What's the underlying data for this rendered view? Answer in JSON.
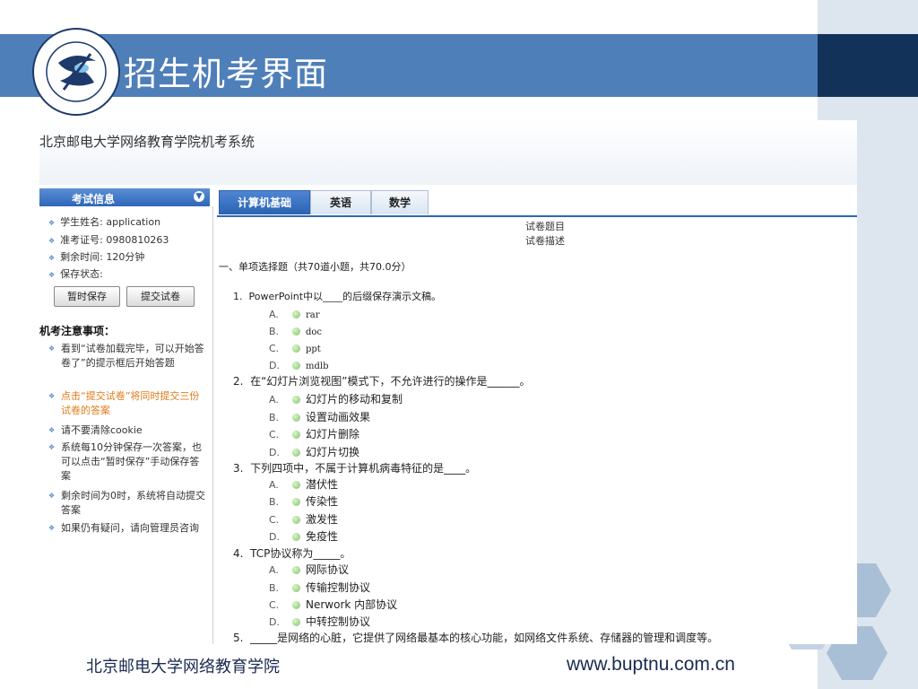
{
  "slide": {
    "title": "招生机考界面",
    "footer_left": "北京邮电大学网络教育学院",
    "footer_right": "www.buptnu.com.cn",
    "colors": {
      "header_blue": "#4f7fb9",
      "header_dark": "#13325a",
      "side_panel": "#dde5ee",
      "hex": "#a9bfd6"
    }
  },
  "app": {
    "system_title": "北京邮电大学网络教育学院机考系统",
    "sidebar": {
      "header": "考试信息",
      "info": [
        "学生姓名: application",
        "准考证号: 0980810263",
        "剩余时间: 120分钟",
        "保存状态:"
      ],
      "buttons": {
        "save": "暂时保存",
        "submit": "提交试卷"
      },
      "notice_title": "机考注意事项：",
      "notices": [
        "看到“试卷加载完毕，可以开始答卷了”的提示框后开始答题",
        "点击“提交试卷”将同时提交三份试卷的答案",
        "请不要清除cookie",
        "系统每10分钟保存一次答案，也可以点击“暂时保存”手动保存答案",
        "剩余时间为0时，系统将自动提交答案",
        "如果仍有疑问，请向管理员咨询"
      ]
    },
    "tabs": [
      "计算机基础",
      "英语",
      "数学"
    ],
    "paper": {
      "title": "试卷题目",
      "description": "试卷描述",
      "section": "一、单项选择题（共70道小题，共70.0分）",
      "questions": [
        {
          "number": "1.",
          "text": "PowerPoint中以____的后缀保存演示文稿。",
          "options": [
            [
              "A.",
              "rar"
            ],
            [
              "B.",
              "doc"
            ],
            [
              "C.",
              "ppt"
            ],
            [
              "D.",
              "mdlb"
            ]
          ]
        },
        {
          "number": "2.",
          "text": "在“幻灯片浏览视图”模式下，不允许进行的操作是______。",
          "options": [
            [
              "A.",
              "幻灯片的移动和复制"
            ],
            [
              "B.",
              "设置动画效果"
            ],
            [
              "C.",
              "幻灯片删除"
            ],
            [
              "D.",
              "幻灯片切换"
            ]
          ]
        },
        {
          "number": "3.",
          "text": "下列四项中，不属于计算机病毒特征的是____。",
          "options": [
            [
              "A.",
              "潜伏性"
            ],
            [
              "B.",
              "传染性"
            ],
            [
              "C.",
              "激发性"
            ],
            [
              "D.",
              "免疫性"
            ]
          ]
        },
        {
          "number": "4.",
          "text": "TCP协议称为_____。",
          "options": [
            [
              "A.",
              "网际协议"
            ],
            [
              "B.",
              "传输控制协议"
            ],
            [
              "C.",
              "Nerwork 内部协议"
            ],
            [
              "D.",
              "中转控制协议"
            ]
          ]
        },
        {
          "number": "5.",
          "text": "_____是网络的心脏，它提供了网络最基本的核心功能，如网络文件系统、存储器的管理和调度等。",
          "options": []
        }
      ]
    }
  }
}
